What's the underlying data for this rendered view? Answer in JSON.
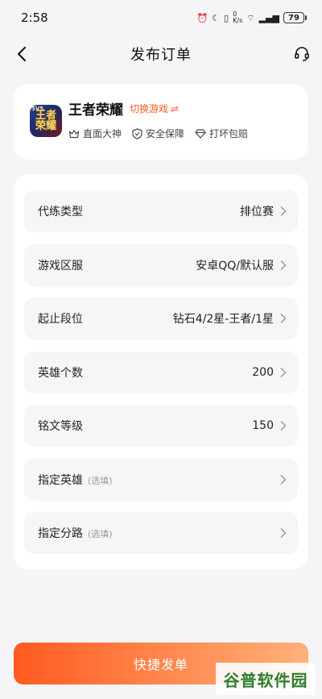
{
  "status_bar": {
    "time": "2:58",
    "net_speed": "0\nK/s",
    "battery": "79"
  },
  "nav": {
    "title": "发布订单",
    "back_icon": "chevron-left-icon",
    "service_icon": "headset-icon"
  },
  "game": {
    "name": "王者荣耀",
    "icon_text": "王者\n荣耀",
    "icon_badge": "5V5",
    "switch_label": "切换游戏",
    "switch_icon": "⇌",
    "features": [
      {
        "label": "直面大神",
        "icon": "crown-icon"
      },
      {
        "label": "安全保障",
        "icon": "shield-icon"
      },
      {
        "label": "打坏包赔",
        "icon": "diamond-icon"
      }
    ]
  },
  "form": {
    "rows": [
      {
        "label": "代练类型",
        "value": "排位赛",
        "hint": ""
      },
      {
        "label": "游戏区服",
        "value": "安卓QQ/默认服",
        "hint": ""
      },
      {
        "label": "起止段位",
        "value": "钻石4/2星-王者/1星",
        "hint": ""
      },
      {
        "label": "英雄个数",
        "value": "200",
        "hint": ""
      },
      {
        "label": "铭文等级",
        "value": "150",
        "hint": ""
      },
      {
        "label": "指定英雄",
        "value": "",
        "hint": "(选填)"
      },
      {
        "label": "指定分路",
        "value": "",
        "hint": "(选填)"
      }
    ]
  },
  "submit_label": "快捷发单",
  "watermark": "谷普软件园",
  "colors": {
    "accent": "#ff5a1f",
    "accent_end": "#ffb27a",
    "background": "#f5f5f7",
    "card": "#ffffff",
    "row_bg": "#f6f6f8"
  }
}
